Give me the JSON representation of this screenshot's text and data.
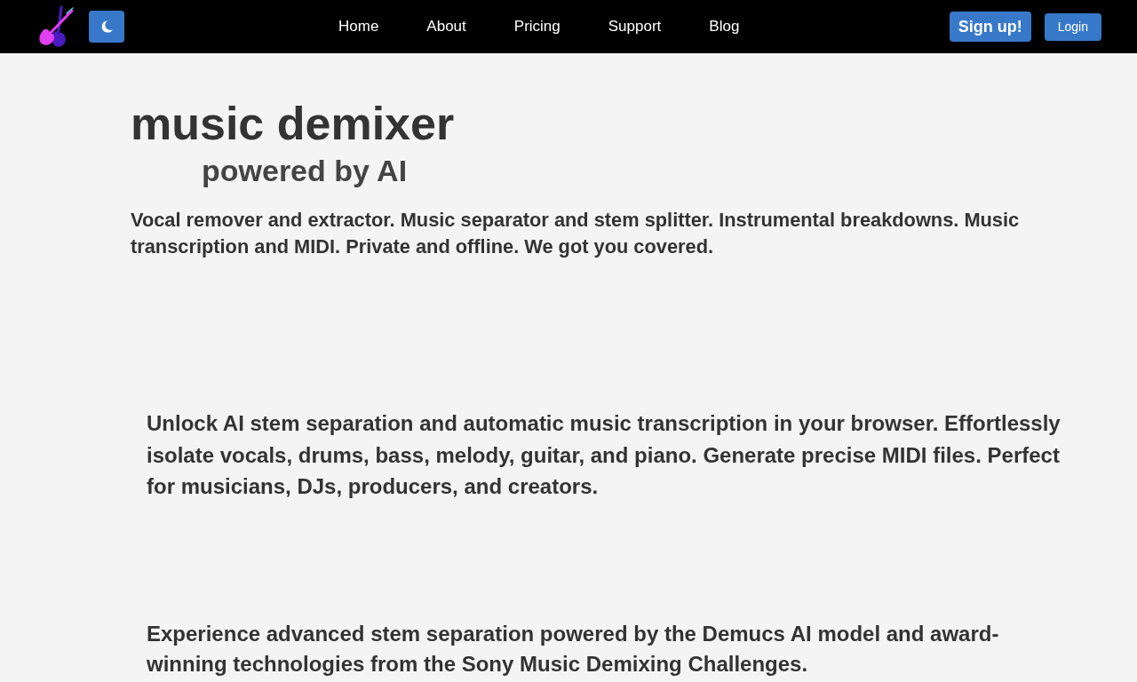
{
  "nav": {
    "links": [
      {
        "label": "Home"
      },
      {
        "label": "About"
      },
      {
        "label": "Pricing"
      },
      {
        "label": "Support"
      },
      {
        "label": "Blog"
      }
    ],
    "buttons": [
      {
        "label": "Sign up!",
        "kind": "primary"
      },
      {
        "label": "Login",
        "kind": "secondary"
      }
    ]
  },
  "hero": {
    "title": "music demixer",
    "subtitle": "powered by AI",
    "tagline": "Vocal remover and extractor. Music separator and stem splitter. Instrumental breakdowns. Music transcription and MIDI. Private and offline. We got you covered."
  },
  "sections": [
    {
      "text": "Unlock AI stem separation and automatic music transcription in your browser. Effortlessly isolate vocals, drums, bass, melody, guitar, and piano. Generate precise MIDI files. Perfect for musicians, DJs, producers, and creators."
    },
    {
      "text": "Experience advanced stem separation powered by the Demucs AI model and award-winning technologies from the Sony Music Demixing Challenges."
    }
  ]
}
